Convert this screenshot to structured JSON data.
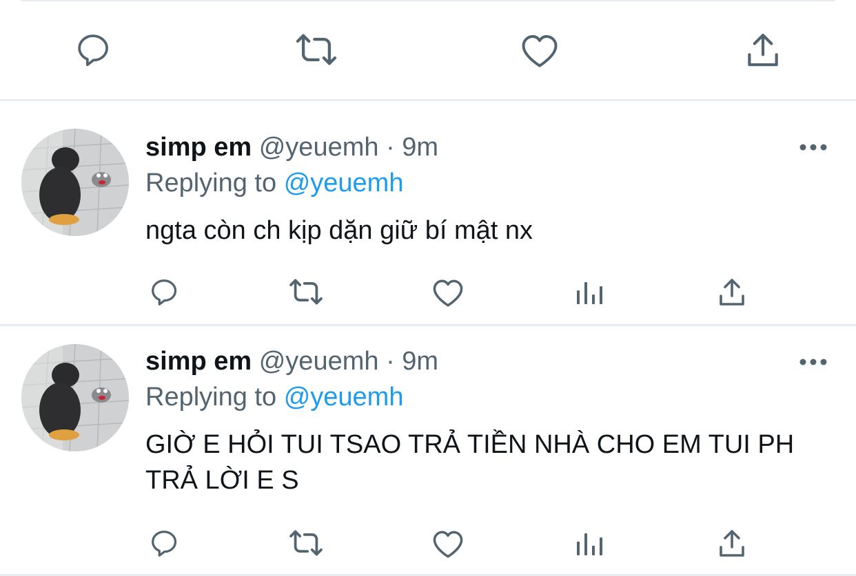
{
  "prev_actions": [
    "reply-icon",
    "retweet-icon",
    "like-icon",
    "share-icon"
  ],
  "tweets": [
    {
      "display_name": "simp em",
      "handle": "@yeuemh",
      "separator": "·",
      "time": "9m",
      "replying_prefix": "Replying to",
      "replying_handle": "@yeuemh",
      "text": "ngta còn ch kịp dặn giữ bí mật nx",
      "actions": [
        "reply-icon",
        "retweet-icon",
        "like-icon",
        "analytics-icon",
        "share-icon"
      ]
    },
    {
      "display_name": "simp em",
      "handle": "@yeuemh",
      "separator": "·",
      "time": "9m",
      "replying_prefix": "Replying to",
      "replying_handle": "@yeuemh",
      "text": "GIỜ E HỎI TUI TSAO TRẢ TIỀN NHÀ CHO EM TUI PH TRẢ LỜI E S",
      "actions": [
        "reply-icon",
        "retweet-icon",
        "like-icon",
        "analytics-icon",
        "share-icon"
      ]
    }
  ],
  "colors": {
    "text": "#0f1419",
    "muted": "#536471",
    "link": "#1d9bf0",
    "divider": "#e6ecf0"
  }
}
